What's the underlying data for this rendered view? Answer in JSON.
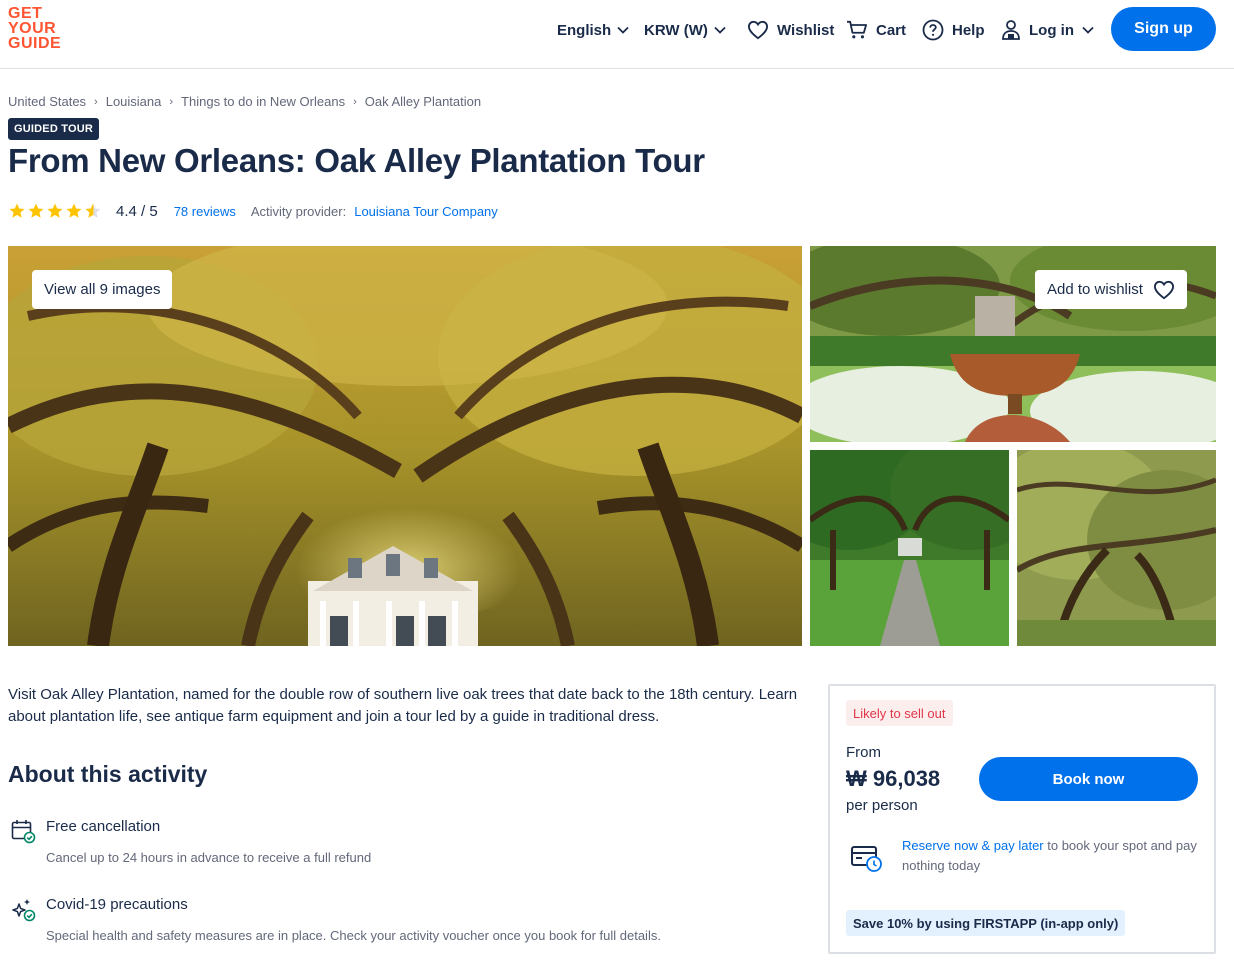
{
  "header": {
    "logo_lines": [
      "GET",
      "YOUR",
      "GUIDE"
    ],
    "language": "English",
    "currency": "KRW (W)",
    "wishlist": "Wishlist",
    "cart": "Cart",
    "help": "Help",
    "login": "Log in",
    "signup": "Sign up"
  },
  "breadcrumb": [
    "United States",
    "Louisiana",
    "Things to do in New Orleans",
    "Oak Alley Plantation"
  ],
  "badge": "GUIDED TOUR",
  "title": "From New Orleans: Oak Alley Plantation Tour",
  "rating": {
    "stars": 4.4,
    "value_text": "4.4 / 5",
    "reviews": "78 reviews",
    "provider_label": "Activity provider:",
    "provider": "Louisiana Tour Company"
  },
  "gallery": {
    "view_all": "View all 9 images",
    "add_wishlist": "Add to wishlist"
  },
  "description": "Visit Oak Alley Plantation, named for the double row of southern live oak trees that date back to the 18th century. Learn about plantation life, see antique farm equipment and join a tour led by a guide in traditional dress.",
  "about": {
    "title": "About this activity",
    "features": [
      {
        "icon": "calendar-check-icon",
        "title": "Free cancellation",
        "desc": "Cancel up to 24 hours in advance to receive a full refund"
      },
      {
        "icon": "sparkles-icon",
        "title": "Covid-19 precautions",
        "desc": "Special health and safety measures are in place. Check your activity voucher once you book for full details."
      }
    ]
  },
  "booking": {
    "sellout": "Likely to sell out",
    "from": "From",
    "price": "₩ 96,038",
    "per_person": "per person",
    "book_now": "Book now",
    "reserve_link": "Reserve now & pay later",
    "reserve_text": " to book your spot and pay nothing today",
    "promo": "Save 10% by using FIRSTAPP (in-app only)"
  },
  "colors": {
    "primary": "#0071eb",
    "brand": "#ff5533",
    "text": "#1a2b49",
    "star": "#ffc400",
    "alert": "#e1364a"
  }
}
